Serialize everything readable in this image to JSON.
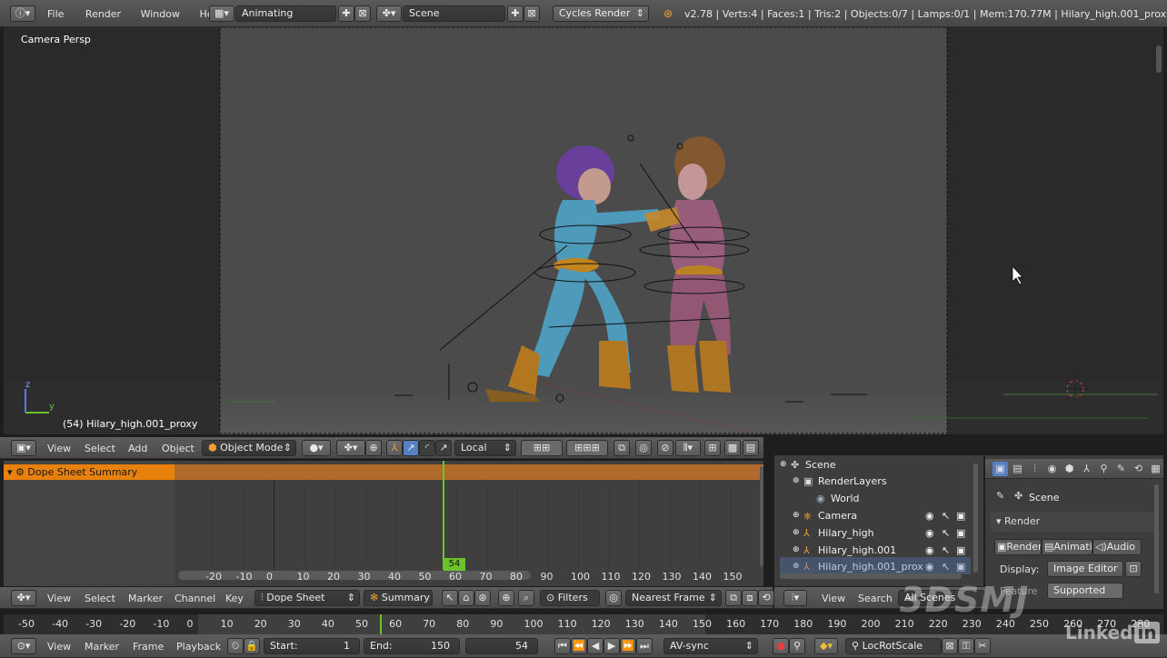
{
  "top_bar": {
    "menus": [
      "File",
      "Render",
      "Window",
      "Help"
    ],
    "screen_layout": "Animating",
    "scene": "Scene",
    "render_engine": "Cycles Render",
    "stats": "v2.78 | Verts:4 | Faces:1 | Tris:2 | Objects:0/7 | Lamps:0/1 | Mem:170.77M | Hilary_high.001_proxy"
  },
  "viewport": {
    "view_label": "Camera Persp",
    "object_label": "(54) Hilary_high.001_proxy",
    "axis_y": "y",
    "axis_z": "z"
  },
  "view3d_header": {
    "menus": [
      "View",
      "Select",
      "Add",
      "Object"
    ],
    "mode": "Object Mode",
    "orientation": "Local"
  },
  "dopesheet": {
    "summary_label": "Dope Sheet Summary",
    "current_frame": "54",
    "ruler_ticks": [
      "-20",
      "-10",
      "0",
      "10",
      "20",
      "30",
      "40",
      "50",
      "60",
      "70",
      "80",
      "90",
      "100",
      "110",
      "120",
      "130",
      "140",
      "150"
    ],
    "header_menus": [
      "View",
      "Select",
      "Marker",
      "Channel",
      "Key"
    ],
    "mode": "Dope Sheet",
    "summary_button": "Summary",
    "filters": "Filters",
    "snap": "Nearest Frame"
  },
  "outliner": {
    "items": [
      {
        "label": "Scene",
        "icon": "scene-icon"
      },
      {
        "label": "RenderLayers",
        "icon": "render-layers-icon"
      },
      {
        "label": "World",
        "icon": "world-icon"
      },
      {
        "label": "Camera",
        "icon": "camera-icon"
      },
      {
        "label": "Hilary_high",
        "icon": "armature-icon"
      },
      {
        "label": "Hilary_high.001",
        "icon": "armature-icon"
      },
      {
        "label": "Hilary_high.001_prox",
        "icon": "armature-icon"
      }
    ],
    "header_menus": [
      "View",
      "Search"
    ],
    "display_mode": "All Scenes"
  },
  "properties": {
    "context": "Scene",
    "panel_title": "Render",
    "tabs": [
      "Render",
      "Animati",
      "Audio"
    ],
    "display_label": "Display:",
    "display_value": "Image Editor",
    "feature_label": "Feature",
    "feature_value": "Supported"
  },
  "timeline": {
    "ruler_ticks": [
      "-50",
      "-40",
      "-30",
      "-20",
      "-10",
      "0",
      "10",
      "20",
      "30",
      "40",
      "50",
      "60",
      "70",
      "80",
      "90",
      "100",
      "110",
      "120",
      "130",
      "140",
      "150",
      "160",
      "170",
      "180",
      "190",
      "200",
      "210",
      "220",
      "230",
      "240",
      "250",
      "260",
      "270",
      "280"
    ],
    "header_menus": [
      "View",
      "Marker",
      "Frame",
      "Playback"
    ],
    "start_label": "Start:",
    "start_value": "1",
    "end_label": "End:",
    "end_value": "150",
    "current_frame": "54",
    "sync": "AV-sync",
    "keying_set": "LocRotScale"
  },
  "watermark": {
    "brand": "3DSMJ",
    "linkedin": "Linked"
  },
  "colors": {
    "accent_orange": "#e8800c",
    "frame_green": "#6ec12a",
    "active_blue": "#5680c2",
    "selected_green_row": "#486a3c"
  }
}
